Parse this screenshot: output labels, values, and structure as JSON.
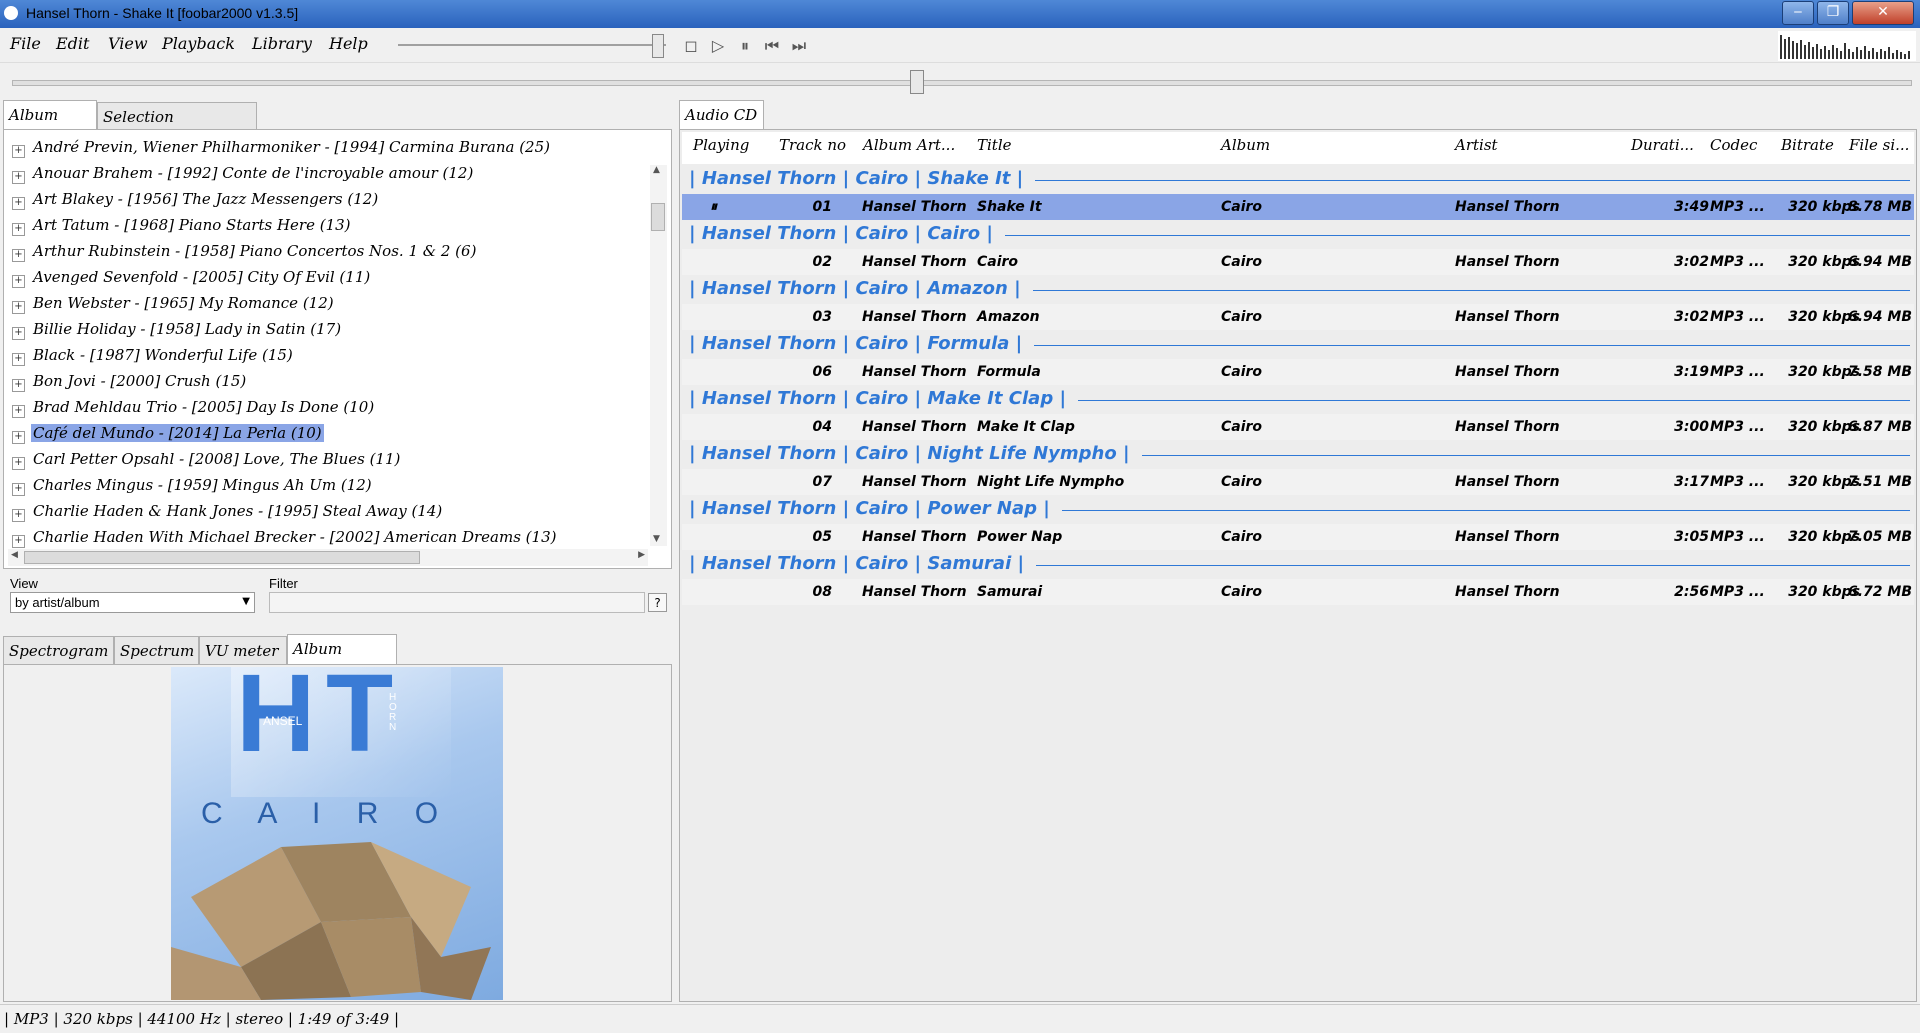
{
  "window": {
    "title": "Hansel Thorn - Shake It  [foobar2000 v1.3.5]",
    "minimize": "‒",
    "maximize": "❐",
    "close": "✕"
  },
  "menu": [
    "File",
    "Edit",
    "View",
    "Playback",
    "Library",
    "Help"
  ],
  "toolbar": {
    "stop": "◻",
    "play": "▷",
    "pause": "⏸",
    "prev": "⏮",
    "next": "⏭"
  },
  "left_tabs": [
    "Album List",
    "Selection Properties"
  ],
  "album_list": [
    "André Previn, Wiener Philharmoniker - [1994] Carmina Burana (25)",
    "Anouar Brahem - [1992] Conte de l'incroyable amour (12)",
    "Art Blakey - [1956] The Jazz Messengers (12)",
    "Art Tatum - [1968] Piano Starts Here (13)",
    "Arthur Rubinstein - [1958] Piano Concertos Nos. 1 & 2 (6)",
    "Avenged Sevenfold - [2005] City Of Evil (11)",
    "Ben Webster - [1965] My Romance (12)",
    "Billie Holiday - [1958] Lady in Satin (17)",
    "Black - [1987] Wonderful Life (15)",
    "Bon Jovi - [2000] Crush (15)",
    "Brad Mehldau Trio - [2005] Day Is Done (10)",
    "Café del Mundo - [2014] La Perla (10)",
    "Carl Petter Opsahl - [2008] Love, The Blues (11)",
    "Charles Mingus - [1959] Mingus Ah Um (12)",
    "Charlie Haden & Hank Jones - [1995] Steal Away (14)",
    "Charlie Haden With Michael Brecker - [2002] American Dreams (13)"
  ],
  "album_list_selected": 11,
  "view": {
    "label": "View",
    "value": "by artist/album"
  },
  "filter": {
    "label": "Filter",
    "help": "?"
  },
  "bottom_tabs": [
    "Spectrogram",
    "Spectrum",
    "VU meter",
    "Album Cover"
  ],
  "cover": {
    "h": "H",
    "t": "T",
    "ansel": "ANSEL",
    "horn": "HORN",
    "cairo": "C A I R O"
  },
  "playlist_tab": "Audio CD",
  "columns": [
    "Playing",
    "Track no",
    "Album Art...",
    "Title",
    "Album",
    "Artist",
    "Durati...",
    "Codec",
    "Bitrate",
    "File si..."
  ],
  "groups": [
    {
      "header": "| Hansel Thorn | Cairo | Shake It |",
      "track": {
        "playing": "⏸",
        "no": "01",
        "album_artist": "Hansel Thorn",
        "title": "Shake It",
        "album": "Cairo",
        "artist": "Hansel Thorn",
        "duration": "3:49",
        "codec": "MP3 ...",
        "bitrate": "320 kbps",
        "size": "8.78 MB"
      }
    },
    {
      "header": "| Hansel Thorn | Cairo | Cairo |",
      "track": {
        "playing": "",
        "no": "02",
        "album_artist": "Hansel Thorn",
        "title": "Cairo",
        "album": "Cairo",
        "artist": "Hansel Thorn",
        "duration": "3:02",
        "codec": "MP3 ...",
        "bitrate": "320 kbps",
        "size": "6.94 MB"
      }
    },
    {
      "header": "| Hansel Thorn | Cairo | Amazon |",
      "track": {
        "playing": "",
        "no": "03",
        "album_artist": "Hansel Thorn",
        "title": "Amazon",
        "album": "Cairo",
        "artist": "Hansel Thorn",
        "duration": "3:02",
        "codec": "MP3 ...",
        "bitrate": "320 kbps",
        "size": "6.94 MB"
      }
    },
    {
      "header": "| Hansel Thorn | Cairo | Formula |",
      "track": {
        "playing": "",
        "no": "06",
        "album_artist": "Hansel Thorn",
        "title": "Formula",
        "album": "Cairo",
        "artist": "Hansel Thorn",
        "duration": "3:19",
        "codec": "MP3 ...",
        "bitrate": "320 kbps",
        "size": "7.58 MB"
      }
    },
    {
      "header": "| Hansel Thorn | Cairo | Make It Clap |",
      "track": {
        "playing": "",
        "no": "04",
        "album_artist": "Hansel Thorn",
        "title": "Make It Clap",
        "album": "Cairo",
        "artist": "Hansel Thorn",
        "duration": "3:00",
        "codec": "MP3 ...",
        "bitrate": "320 kbps",
        "size": "6.87 MB"
      }
    },
    {
      "header": "| Hansel Thorn | Cairo | Night Life Nympho |",
      "track": {
        "playing": "",
        "no": "07",
        "album_artist": "Hansel Thorn",
        "title": "Night Life Nympho",
        "album": "Cairo",
        "artist": "Hansel Thorn",
        "duration": "3:17",
        "codec": "MP3 ...",
        "bitrate": "320 kbps",
        "size": "7.51 MB"
      }
    },
    {
      "header": "| Hansel Thorn | Cairo | Power Nap |",
      "track": {
        "playing": "",
        "no": "05",
        "album_artist": "Hansel Thorn",
        "title": "Power Nap",
        "album": "Cairo",
        "artist": "Hansel Thorn",
        "duration": "3:05",
        "codec": "MP3 ...",
        "bitrate": "320 kbps",
        "size": "7.05 MB"
      }
    },
    {
      "header": "| Hansel Thorn | Cairo | Samurai |",
      "track": {
        "playing": "",
        "no": "08",
        "album_artist": "Hansel Thorn",
        "title": "Samurai",
        "album": "Cairo",
        "artist": "Hansel Thorn",
        "duration": "2:56",
        "codec": "MP3 ...",
        "bitrate": "320 kbps",
        "size": "6.72 MB"
      }
    }
  ],
  "status": "| MP3 | 320 kbps | 44100 Hz | stereo | 1:49 of 3:49 |",
  "colors": {
    "accent": "#2f78d6",
    "selection": "#8aa5e6"
  }
}
